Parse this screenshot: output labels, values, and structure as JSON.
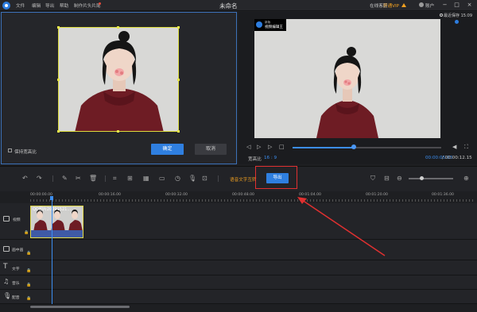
{
  "titlebar": {
    "menus": [
      "文件",
      "编辑",
      "导出",
      "帮助",
      "制作片头片尾"
    ],
    "title": "未命名",
    "online_support": "在线客服",
    "vip": "开通VIP",
    "account": "账户",
    "window_buttons": [
      "−",
      "□",
      "×"
    ]
  },
  "crop": {
    "keep_ratio_label": "保持宽高比",
    "confirm": "确定",
    "cancel": "取消"
  },
  "preview": {
    "autosave": "最近保存 15:09",
    "watermark_small": "新版",
    "watermark_name": "视频编辑王",
    "ratio_label": "宽高比",
    "ratio_value": "16 : 9",
    "time_current": "00:00:05.03",
    "time_total": "/ 00:00:12.15",
    "progress": 0.41
  },
  "toolbar": {
    "speech_to_text": "语音文字互转",
    "export": "导出"
  },
  "timeline": {
    "ticks": [
      "00:00:00.00",
      "00:00:16.00",
      "00:00:32.00",
      "00:00:48.00",
      "00:01:04.00",
      "00:01:20.00",
      "00:01:36.00"
    ],
    "tracks": [
      "视频",
      "画中画",
      "文字",
      "音乐",
      "配音"
    ],
    "clip_label": "QQ图片20091521..."
  },
  "colors": {
    "accent": "#2f7fe0",
    "vip": "#f0a020",
    "highlight": "#e03030"
  }
}
